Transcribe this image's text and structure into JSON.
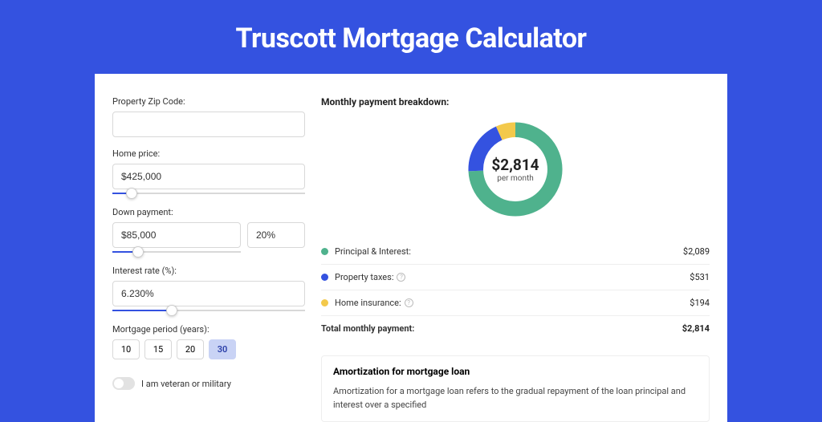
{
  "title": "Truscott Mortgage Calculator",
  "form": {
    "zip_label": "Property Zip Code:",
    "zip_value": "",
    "price_label": "Home price:",
    "price_value": "$425,000",
    "price_slider_pct": 10,
    "down_label": "Down payment:",
    "down_amount": "$85,000",
    "down_pct": "20%",
    "down_slider_pct": 20,
    "rate_label": "Interest rate (%):",
    "rate_value": "6.230%",
    "rate_slider_pct": 31,
    "period_label": "Mortgage period (years):",
    "periods": [
      "10",
      "15",
      "20",
      "30"
    ],
    "period_active": "30",
    "veteran_label": "I am veteran or military"
  },
  "breakdown": {
    "heading": "Monthly payment breakdown:",
    "center_amount": "$2,814",
    "center_label": "per month",
    "items": [
      {
        "label": "Principal & Interest:",
        "value": "$2,089",
        "color": "#4fb28d",
        "pct": 74.2,
        "info": false
      },
      {
        "label": "Property taxes:",
        "value": "$531",
        "color": "#3452e0",
        "pct": 18.9,
        "info": true
      },
      {
        "label": "Home insurance:",
        "value": "$194",
        "color": "#f3c94b",
        "pct": 6.9,
        "info": true
      }
    ],
    "total_label": "Total monthly payment:",
    "total_value": "$2,814"
  },
  "amort": {
    "heading": "Amortization for mortgage loan",
    "text": "Amortization for a mortgage loan refers to the gradual repayment of the loan principal and interest over a specified"
  },
  "chart_data": {
    "type": "pie",
    "title": "Monthly payment breakdown",
    "categories": [
      "Principal & Interest",
      "Property taxes",
      "Home insurance"
    ],
    "values": [
      2089,
      531,
      194
    ],
    "colors": [
      "#4fb28d",
      "#3452e0",
      "#f3c94b"
    ],
    "total": 2814,
    "center_label": "$2,814 per month"
  }
}
